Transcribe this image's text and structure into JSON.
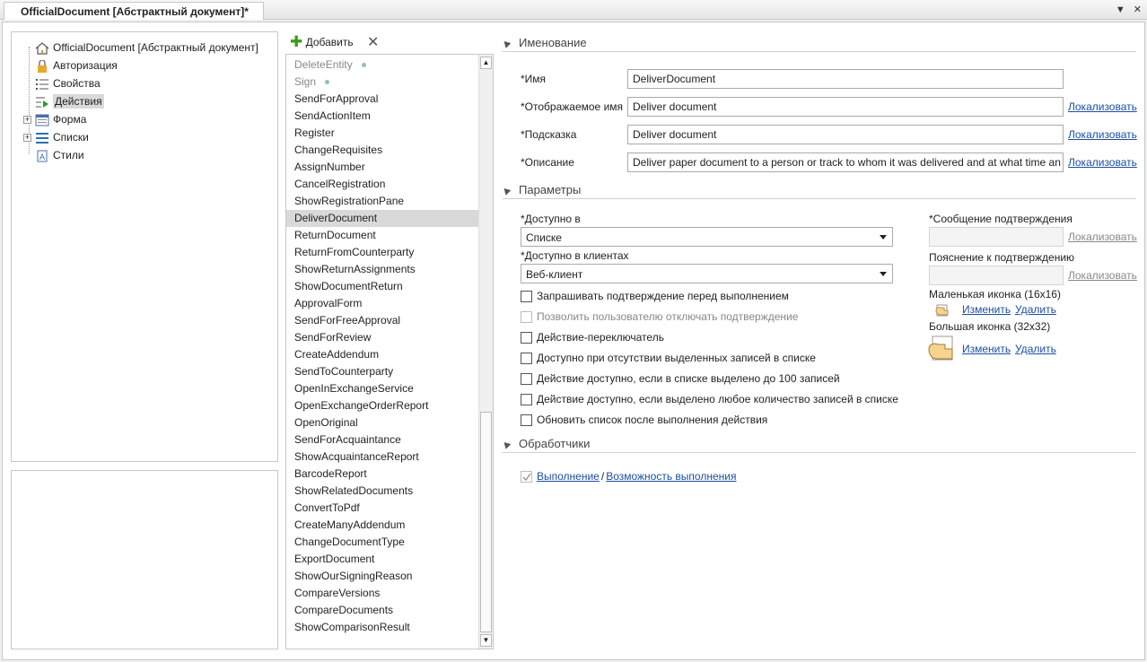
{
  "tab": {
    "title": "OfficialDocument [Абстрактный документ]*"
  },
  "tree": [
    {
      "label": "OfficialDocument [Абстрактный документ]",
      "icon": "home-icon"
    },
    {
      "label": "Авторизация",
      "icon": "lock-icon"
    },
    {
      "label": "Свойства",
      "icon": "properties-icon"
    },
    {
      "label": "Действия",
      "icon": "actions-icon"
    },
    {
      "label": "Форма",
      "icon": "form-icon"
    },
    {
      "label": "Списки",
      "icon": "lists-icon"
    },
    {
      "label": "Стили",
      "icon": "styles-icon"
    }
  ],
  "toolbar": {
    "add_label": "Добавить"
  },
  "actions": [
    "DeleteEntity",
    "Sign",
    "SendForApproval",
    "SendActionItem",
    "Register",
    "ChangeRequisites",
    "AssignNumber",
    "CancelRegistration",
    "ShowRegistrationPane",
    "DeliverDocument",
    "ReturnDocument",
    "ReturnFromCounterparty",
    "ShowReturnAssignments",
    "ShowDocumentReturn",
    "ApprovalForm",
    "SendForFreeApproval",
    "SendForReview",
    "CreateAddendum",
    "SendToCounterparty",
    "OpenInExchangeService",
    "OpenExchangeOrderReport",
    "OpenOriginal",
    "SendForAcquaintance",
    "ShowAcquaintanceReport",
    "BarcodeReport",
    "ShowRelatedDocuments",
    "ConvertToPdf",
    "CreateManyAddendum",
    "ChangeDocumentType",
    "ExportDocument",
    "ShowOurSigningReason",
    "CompareVersions",
    "CompareDocuments",
    "ShowComparisonResult"
  ],
  "naming": {
    "section": "Именование",
    "name_label": "*Имя",
    "name_value": "DeliverDocument",
    "display_label": "*Отображаемое имя",
    "display_value": "Deliver document",
    "hint_label": "*Подсказка",
    "hint_value": "Deliver document",
    "desc_label": "*Описание",
    "desc_value": "Deliver paper document to a person or track to whom it was delivered and at what time an",
    "localize": "Локализовать"
  },
  "params": {
    "section": "Параметры",
    "available_in_label": "*Доступно в",
    "available_in_value": "Списке",
    "clients_label": "*Доступно в клиентах",
    "clients_value": "Веб-клиент",
    "checkboxes": [
      "Запрашивать подтверждение перед выполнением",
      "Позволить пользователю отключать подтверждение",
      "Действие-переключатель",
      "Доступно при отсутствии выделенных записей в списке",
      "Действие доступно, если в списке выделено до 100 записей",
      "Действие доступно, если выделено любое количество записей в списке",
      "Обновить список после выполнения действия"
    ],
    "confirm_msg_label": "*Сообщение подтверждения",
    "confirm_expl_label": "Пояснение к подтверждению",
    "small_icon_label": "Маленькая иконка (16x16)",
    "large_icon_label": "Большая иконка (32x32)",
    "change": "Изменить",
    "delete": "Удалить"
  },
  "handlers": {
    "section": "Обработчики",
    "execute": "Выполнение",
    "separator": "/",
    "can_execute": "Возможность выполнения"
  }
}
